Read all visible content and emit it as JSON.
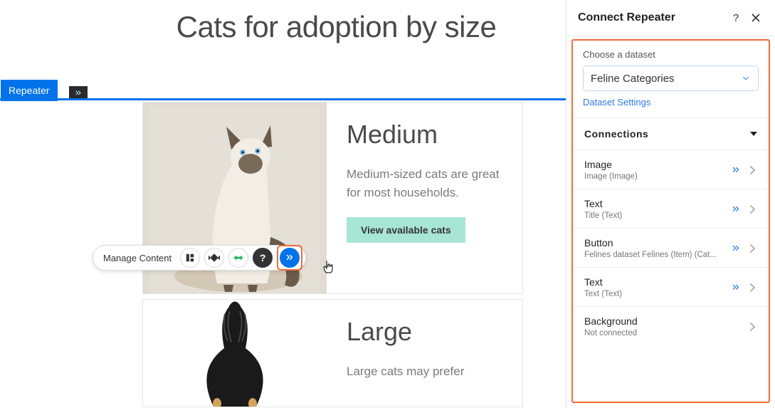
{
  "page": {
    "title": "Cats for adoption by size"
  },
  "repeater": {
    "label": "Repeater"
  },
  "toolbar": {
    "manage_content": "Manage Content"
  },
  "cards": [
    {
      "heading": "Medium",
      "text": "Medium-sized cats are great for most households.",
      "button": "View available cats"
    },
    {
      "heading": "Large",
      "text": "Large cats may prefer"
    }
  ],
  "panel": {
    "title": "Connect Repeater",
    "dataset": {
      "label": "Choose a dataset",
      "value": "Feline Categories",
      "settings_link": "Dataset Settings"
    },
    "connections_label": "Connections",
    "rows": [
      {
        "title": "Image",
        "sub": "Image (Image)",
        "connected": true
      },
      {
        "title": "Text",
        "sub": "Title (Text)",
        "connected": true
      },
      {
        "title": "Button",
        "sub": "Felines dataset Felines (Item) (Cat...",
        "connected": true
      },
      {
        "title": "Text",
        "sub": "Text (Text)",
        "connected": true
      },
      {
        "title": "Background",
        "sub": "Not connected",
        "connected": false
      }
    ]
  }
}
